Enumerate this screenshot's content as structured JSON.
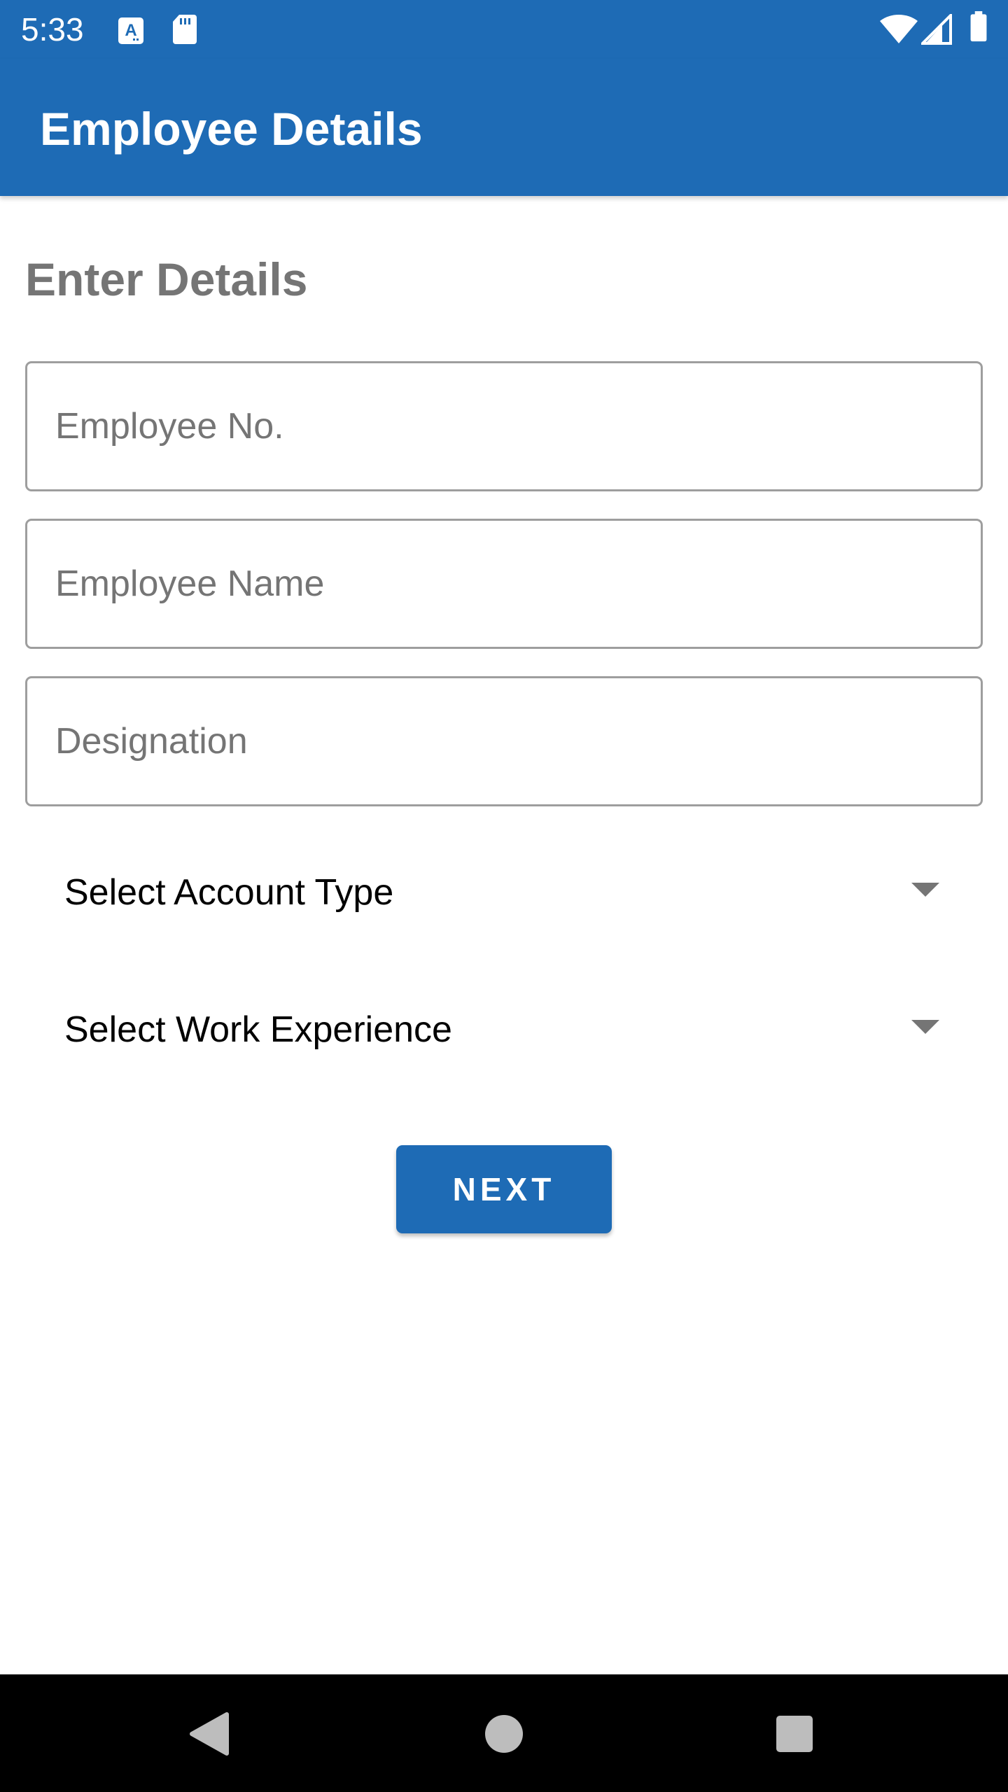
{
  "status_bar": {
    "time": "5:33",
    "left_icons": [
      "font-notification-icon",
      "sd-card-icon"
    ],
    "right_icons": [
      "wifi-icon",
      "cell-signal-icon",
      "battery-icon"
    ]
  },
  "app_bar": {
    "title": "Employee Details",
    "color": "#1e6bb5"
  },
  "form": {
    "heading": "Enter Details",
    "fields": [
      {
        "placeholder": "Employee No.",
        "value": ""
      },
      {
        "placeholder": "Employee Name",
        "value": ""
      },
      {
        "placeholder": "Designation",
        "value": ""
      }
    ],
    "dropdowns": [
      {
        "selected": "Select Account Type"
      },
      {
        "selected": "Select Work Experience"
      }
    ],
    "next_label": "NEXT"
  },
  "nav_bar": {
    "buttons": [
      "back-icon",
      "home-icon",
      "recents-icon"
    ]
  }
}
